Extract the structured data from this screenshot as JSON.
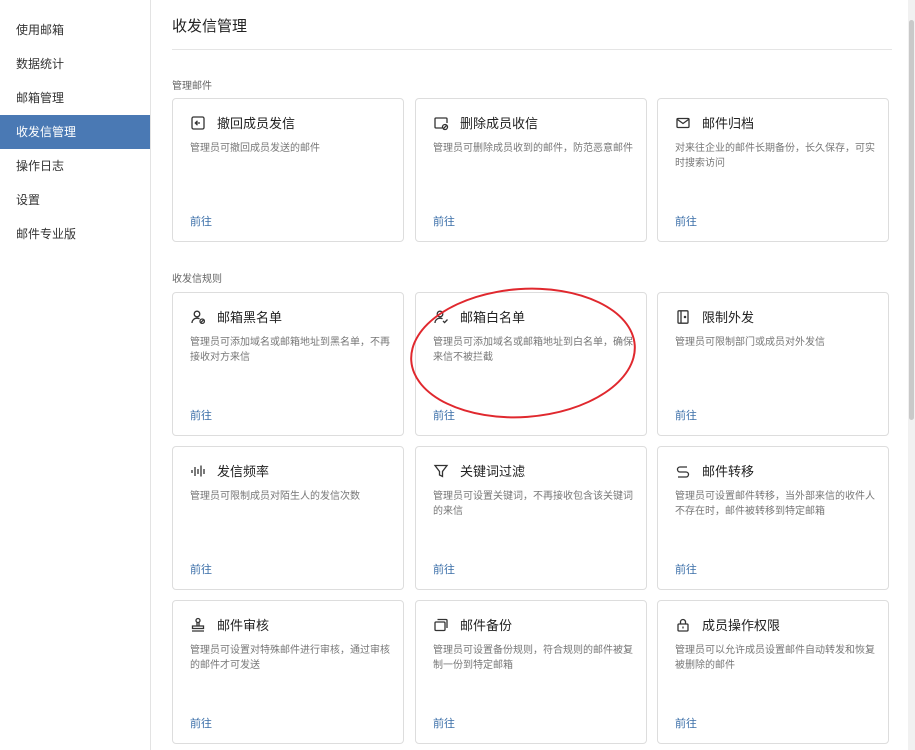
{
  "sidebar": {
    "items": [
      {
        "label": "使用邮箱"
      },
      {
        "label": "数据统计"
      },
      {
        "label": "邮箱管理"
      },
      {
        "label": "收发信管理",
        "active": true
      },
      {
        "label": "操作日志"
      },
      {
        "label": "设置"
      },
      {
        "label": "邮件专业版"
      }
    ]
  },
  "page": {
    "title": "收发信管理"
  },
  "sections": [
    {
      "label": "管理邮件",
      "cards": [
        {
          "icon": "recall-icon",
          "title": "撤回成员发信",
          "desc": "管理员可撤回成员发送的邮件",
          "link": "前往"
        },
        {
          "icon": "delete-mail-icon",
          "title": "删除成员收信",
          "desc": "管理员可删除成员收到的邮件，防范恶意邮件",
          "link": "前往"
        },
        {
          "icon": "mail-icon",
          "title": "邮件归档",
          "desc": "对来往企业的邮件长期备份，长久保存，可实时搜索访问",
          "link": "前往"
        }
      ]
    },
    {
      "label": "收发信规则",
      "cards": [
        {
          "icon": "user-block-icon",
          "title": "邮箱黑名单",
          "desc": "管理员可添加域名或邮箱地址到黑名单，不再接收对方来信",
          "link": "前往"
        },
        {
          "icon": "user-allow-icon",
          "title": "邮箱白名单",
          "desc": "管理员可添加域名或邮箱地址到白名单，确保来信不被拦截",
          "link": "前往"
        },
        {
          "icon": "door-icon",
          "title": "限制外发",
          "desc": "管理员可限制部门或成员对外发信",
          "link": "前往"
        },
        {
          "icon": "frequency-icon",
          "title": "发信频率",
          "desc": "管理员可限制成员对陌生人的发信次数",
          "link": "前往"
        },
        {
          "icon": "filter-icon",
          "title": "关键词过滤",
          "desc": "管理员可设置关键词，不再接收包含该关键词的来信",
          "link": "前往"
        },
        {
          "icon": "forward-icon",
          "title": "邮件转移",
          "desc": "管理员可设置邮件转移，当外部来信的收件人不存在时，邮件被转移到特定邮箱",
          "link": "前往"
        },
        {
          "icon": "stamp-icon",
          "title": "邮件审核",
          "desc": "管理员可设置对特殊邮件进行审核，通过审核的邮件才可发送",
          "link": "前往"
        },
        {
          "icon": "backup-icon",
          "title": "邮件备份",
          "desc": "管理员可设置备份规则，符合规则的邮件被复制一份到特定邮箱",
          "link": "前往"
        },
        {
          "icon": "lock-icon",
          "title": "成员操作权限",
          "desc": "管理员可以允许成员设置邮件自动转发和恢复被删除的邮件",
          "link": "前往"
        }
      ]
    }
  ],
  "colors": {
    "accent": "#4a79b4",
    "link": "#3a6ea8",
    "annotation": "#e0282e"
  }
}
